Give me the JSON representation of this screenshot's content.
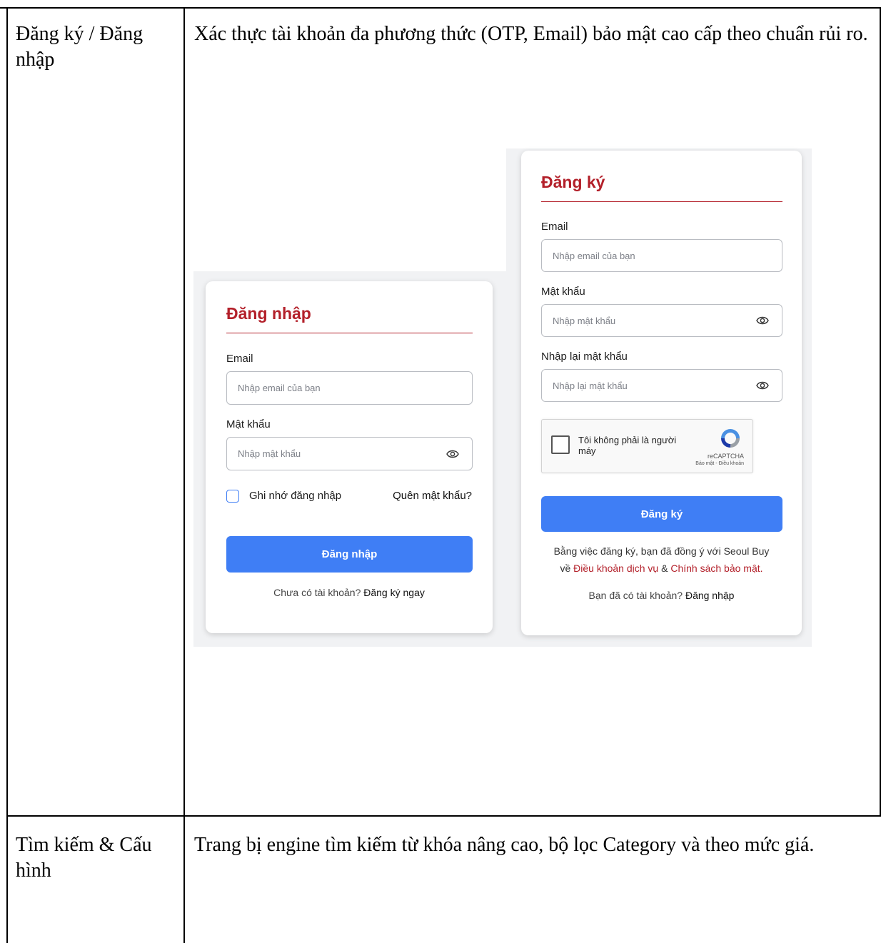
{
  "rows": [
    {
      "feature": "Đăng ký / Đăng nhập",
      "description": "Xác thực tài khoản đa phương thức (OTP, Email) bảo mật cao cấp theo chuẩn rủi ro."
    },
    {
      "feature": "Tìm kiếm & Cấu hình",
      "description": "Trang bị engine tìm kiếm từ khóa nâng cao, bộ lọc Category và theo mức giá."
    }
  ],
  "login": {
    "title": "Đăng nhập",
    "email_label": "Email",
    "email_placeholder": "Nhập email của bạn",
    "password_label": "Mật khẩu",
    "password_placeholder": "Nhập mật khẩu",
    "remember_label": "Ghi nhớ đăng nhập",
    "forgot_link": "Quên mật khẩu?",
    "submit_label": "Đăng nhập",
    "no_account_text": "Chưa có tài khoản?",
    "register_link": "Đăng ký ngay"
  },
  "register": {
    "title": "Đăng ký",
    "email_label": "Email",
    "email_placeholder": "Nhập email của bạn",
    "password_label": "Mật khẩu",
    "password_placeholder": "Nhập mật khẩu",
    "confirm_label": "Nhập lại mật khẩu",
    "confirm_placeholder": "Nhập lại mật khẩu",
    "captcha_text": "Tôi không phải là người máy",
    "captcha_brand": "reCAPTCHA",
    "captcha_links": "Bảo mật - Điều khoản",
    "submit_label": "Đăng ký",
    "terms_line1": "Bằng việc đăng ký, bạn đã đồng ý với Seoul Buy",
    "terms_prefix": "về",
    "terms_link": "Điều khoản dịch vụ",
    "terms_and": "&",
    "privacy_link": "Chính sách bảo mật",
    "terms_end": ".",
    "have_account_text": "Bạn đã có tài khoản?",
    "login_link": "Đăng nhập"
  },
  "colors": {
    "brand_red": "#b3202a",
    "primary_blue": "#3f7ef5"
  }
}
